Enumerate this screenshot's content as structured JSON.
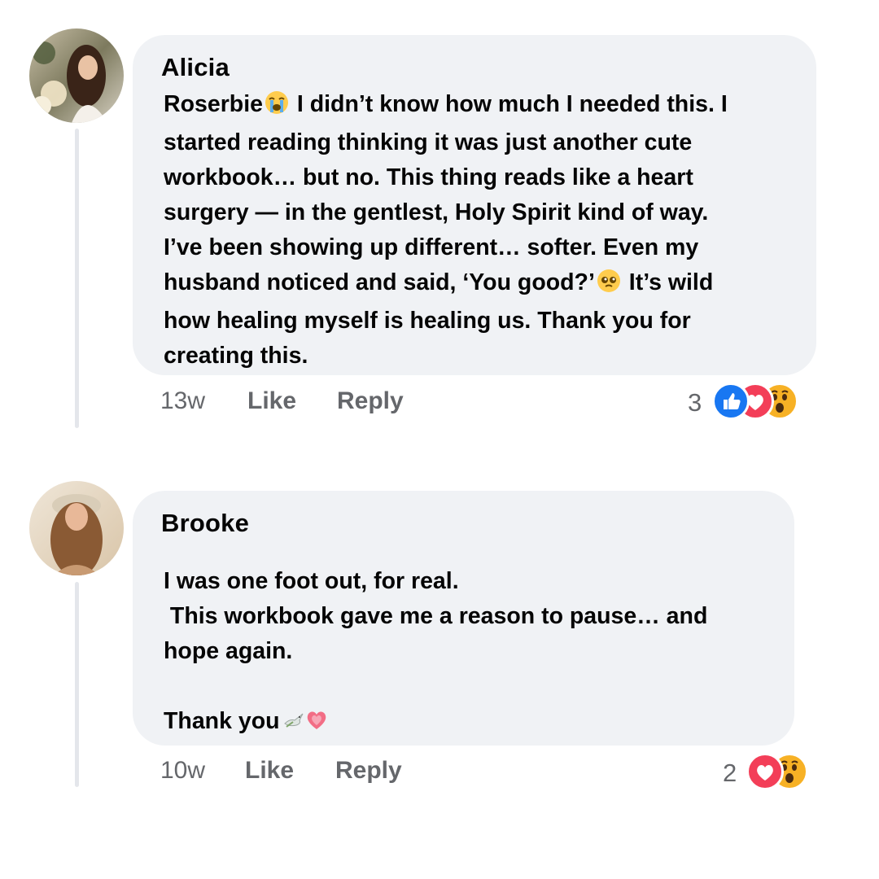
{
  "comments": [
    {
      "author": "Alicia",
      "text_parts": [
        "Roserbie",
        " I didn’t know how much I needed this. I\nstarted reading thinking it was just another cute\nworkbook… but no. This thing reads like a heart\nsurgery — in the gentlest, Holy Spirit kind of way.\nI’ve been showing up different… softer. Even my\nhusband noticed and said, ‘You good?’",
        " It’s wild\nhow healing myself is healing us. Thank you for\ncreating this."
      ],
      "emojis": [
        "loudly-crying-face-icon",
        "pleading-face-icon"
      ],
      "time": "13w",
      "like_label": "Like",
      "reply_label": "Reply",
      "reaction_count": "3",
      "reactions": [
        "like-icon",
        "love-icon",
        "wow-icon"
      ]
    },
    {
      "author": "Brooke",
      "text_parts": [
        "I was one foot out, for real.\n This workbook gave me a reason to pause… and\nhope again.\n\nThank you"
      ],
      "emojis": [
        "dove-icon",
        "heart-icon"
      ],
      "time": "10w",
      "like_label": "Like",
      "reply_label": "Reply",
      "reaction_count": "2",
      "reactions": [
        "love-icon",
        "wow-icon"
      ]
    }
  ],
  "colors": {
    "bubble": "#f0f2f5",
    "muted_text": "#65676b",
    "like_blue": "#1877f2",
    "love_red": "#f33e58",
    "wow_yellow": "#f7b125"
  }
}
